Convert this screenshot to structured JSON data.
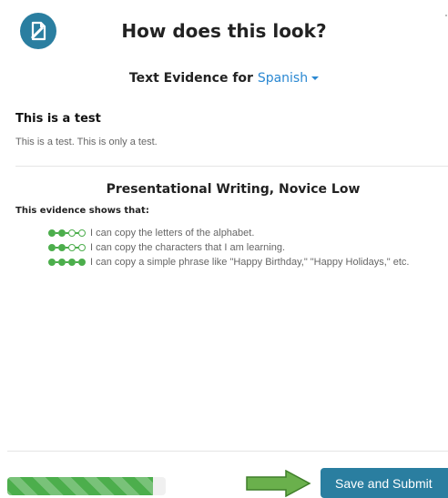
{
  "modal": {
    "title": "How does this look?"
  },
  "evidence": {
    "prefix": "Text Evidence for",
    "language": "Spanish"
  },
  "entry": {
    "title": "This is a test",
    "body": "This is a test. This is only a test."
  },
  "standard": {
    "title": "Presentational Writing, Novice Low",
    "shows_label": "This evidence shows that:",
    "can_do": [
      {
        "text": "I can copy the letters of the alphabet.",
        "level": 2,
        "max": 4
      },
      {
        "text": "I can copy the characters that I am learning.",
        "level": 2,
        "max": 4
      },
      {
        "text": "I can copy a simple phrase like \"Happy Birthday,\" \"Happy Holidays,\" etc.",
        "level": 4,
        "max": 4
      }
    ]
  },
  "footer": {
    "progress_fraction": 0.92,
    "submit_label": "Save and Submit"
  },
  "colors": {
    "primary": "#2a7ea0",
    "link": "#2a88d2",
    "success": "#4cae4c"
  },
  "icons": {
    "logo": "document-edit-icon",
    "annotation": "right-arrow-icon"
  }
}
